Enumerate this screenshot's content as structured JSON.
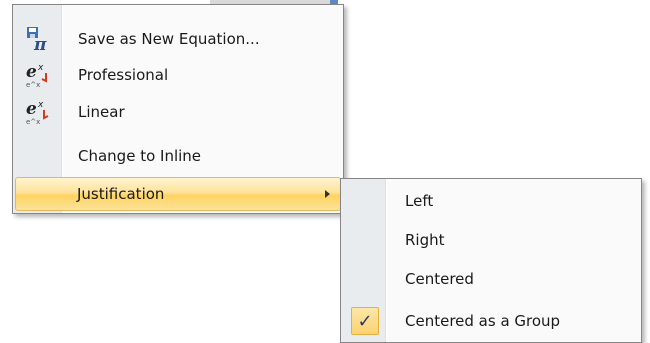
{
  "main_menu": {
    "items": [
      {
        "label": "Save as New Equation...",
        "icon": "pi-save-icon"
      },
      {
        "label": "Professional",
        "icon": "equation-professional-icon"
      },
      {
        "label": "Linear",
        "icon": "equation-linear-icon"
      },
      {
        "label": "Change to Inline",
        "icon": ""
      },
      {
        "label": "Justification",
        "icon": "",
        "submenu_arrow": "▸",
        "state": "highlighted"
      }
    ]
  },
  "justification_submenu": {
    "items": [
      {
        "label": "Left"
      },
      {
        "label": "Right"
      },
      {
        "label": "Centered"
      },
      {
        "label": "Centered as a Group",
        "checked": true,
        "check_glyph": "✓"
      }
    ]
  },
  "colors": {
    "highlight": "#ffd35e",
    "gutter": "#e9ecee",
    "menu_bg": "#fafafa"
  }
}
